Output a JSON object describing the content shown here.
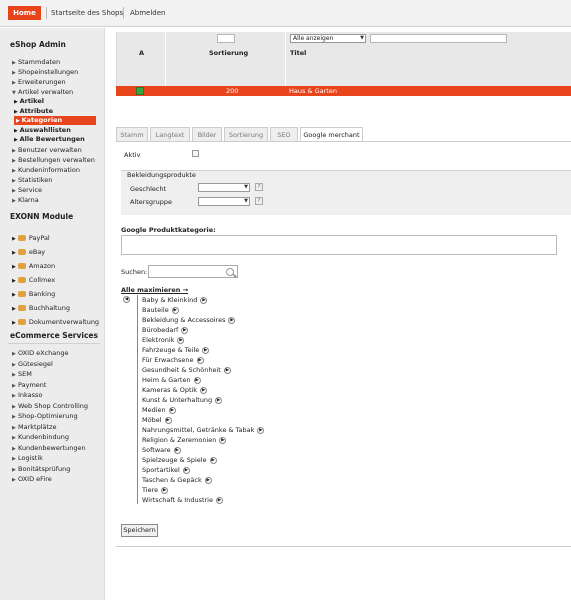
{
  "topbar": {
    "home": "Home",
    "shop_start": "Startseite des Shops",
    "logout": "Abmelden"
  },
  "sidebar": {
    "eshop_admin": "eShop Admin",
    "items": [
      "Stammdaten",
      "Shopeinstellungen",
      "Erweiterungen",
      "Artikel verwalten"
    ],
    "subitems": [
      "Artikel",
      "Attribute",
      "Kategorien",
      "Auswahllisten",
      "Alle Bewertungen"
    ],
    "items2": [
      "Benutzer verwalten",
      "Bestellungen verwalten",
      "Kundeninformation",
      "Statistiken",
      "Service",
      "Klarna"
    ],
    "exonn_module": "EXONN Module",
    "modules": [
      "PayPal",
      "eBay",
      "Amazon",
      "Collmex",
      "Banking",
      "Buchhaltung",
      "Dokumentverwaltung"
    ],
    "ecommerce_services": "eCommerce Services",
    "services": [
      "OXID eXchange",
      "Gütesiegel",
      "SEM",
      "Payment",
      "Inkasso",
      "Web Shop Controlling",
      "Shop-Optimierung",
      "Marktplätze",
      "Kundenbindung",
      "Kundenbewertungen",
      "Logistik",
      "Bonitätsprüfung",
      "OXID eFire"
    ]
  },
  "list": {
    "filter_select": "Alle anzeigen",
    "col_a": "A",
    "col_sort": "Sortierung",
    "col_title": "Titel",
    "row_sort": "200",
    "row_title": "Haus & Garten"
  },
  "tabs": [
    "Stamm",
    "Langtext",
    "Bilder",
    "Sortierung",
    "SEO",
    "Google merchant"
  ],
  "form": {
    "active_label": "Aktiv",
    "clothing_legend": "Bekleidungsprodukte",
    "gender_label": "Geschlecht",
    "age_label": "Altersgruppe",
    "help": "?",
    "google_category_label": "Google Produktkategorie:",
    "search_label": "Suchen:",
    "maximize": "Alle maximieren",
    "maximize_arrow": "→",
    "save": "Speichern"
  },
  "tree": [
    "Baby & Kleinkind",
    "Bauteile",
    "Bekleidung & Accessoires",
    "Bürobedarf",
    "Elektronik",
    "Fahrzeuge & Teile",
    "Für Erwachsene",
    "Gesundheit & Schönheit",
    "Heim & Garten",
    "Kameras & Optik",
    "Kunst & Unterhaltung",
    "Medien",
    "Möbel",
    "Nahrungsmittel, Getränke & Tabak",
    "Religion & Zeremonien",
    "Software",
    "Spielzeuge & Spiele",
    "Sportartikel",
    "Taschen & Gepäck",
    "Tiere",
    "Wirtschaft & Industrie"
  ],
  "colors": {
    "accent": "#e8451d",
    "active_green": "#3da33d"
  }
}
